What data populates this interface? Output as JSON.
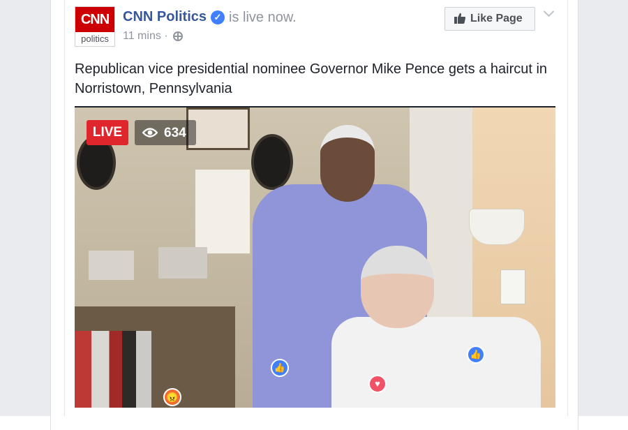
{
  "post": {
    "logo": {
      "top_text": "CNN",
      "bottom_text": "politics"
    },
    "page_name": "CNN Politics",
    "status": "is live now.",
    "time": "11 mins",
    "meta_separator": "·",
    "like_button_label": "Like Page",
    "caption": "Republican vice presidential nominee Governor Mike Pence gets a haircut in Norristown, Pennsylvania"
  },
  "video": {
    "live_label": "LIVE",
    "viewer_count": "634",
    "reactions": [
      "like",
      "love",
      "like",
      "angry"
    ]
  },
  "colors": {
    "page_name": "#365899",
    "live_badge": "#e0262d",
    "verified": "#4080ff",
    "like_reaction": "#4080ff",
    "love_reaction": "#f25268"
  }
}
